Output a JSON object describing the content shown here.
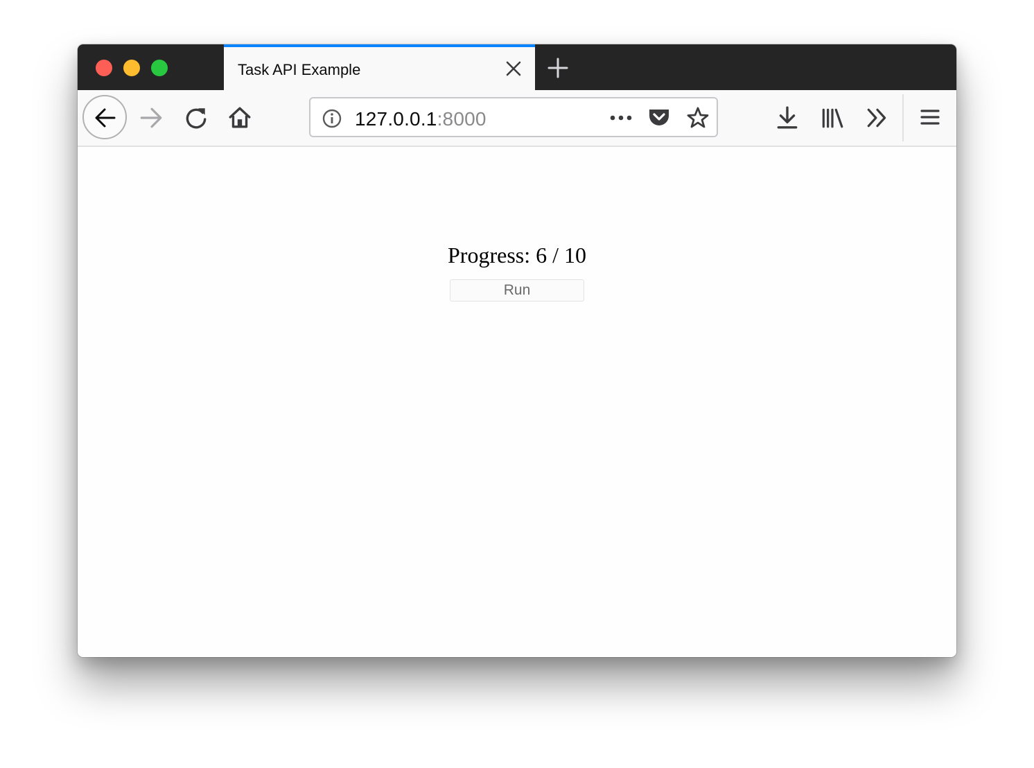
{
  "browser": {
    "tab": {
      "title": "Task API Example",
      "accent_color": "#0a84ff"
    },
    "url": {
      "host": "127.0.0.1",
      "port": ":8000"
    }
  },
  "icons": {
    "window_controls": [
      "close-dot-icon",
      "minimize-dot-icon",
      "maximize-dot-icon"
    ],
    "toolbar": [
      "back-arrow-icon",
      "forward-arrow-icon",
      "reload-icon",
      "home-icon",
      "info-icon",
      "more-dots-icon",
      "pocket-icon",
      "star-icon",
      "download-icon",
      "library-icon",
      "overflow-chevron-icon",
      "hamburger-menu-icon"
    ]
  },
  "page": {
    "progress_text": "Progress: 6 / 10",
    "run_label": "Run"
  }
}
